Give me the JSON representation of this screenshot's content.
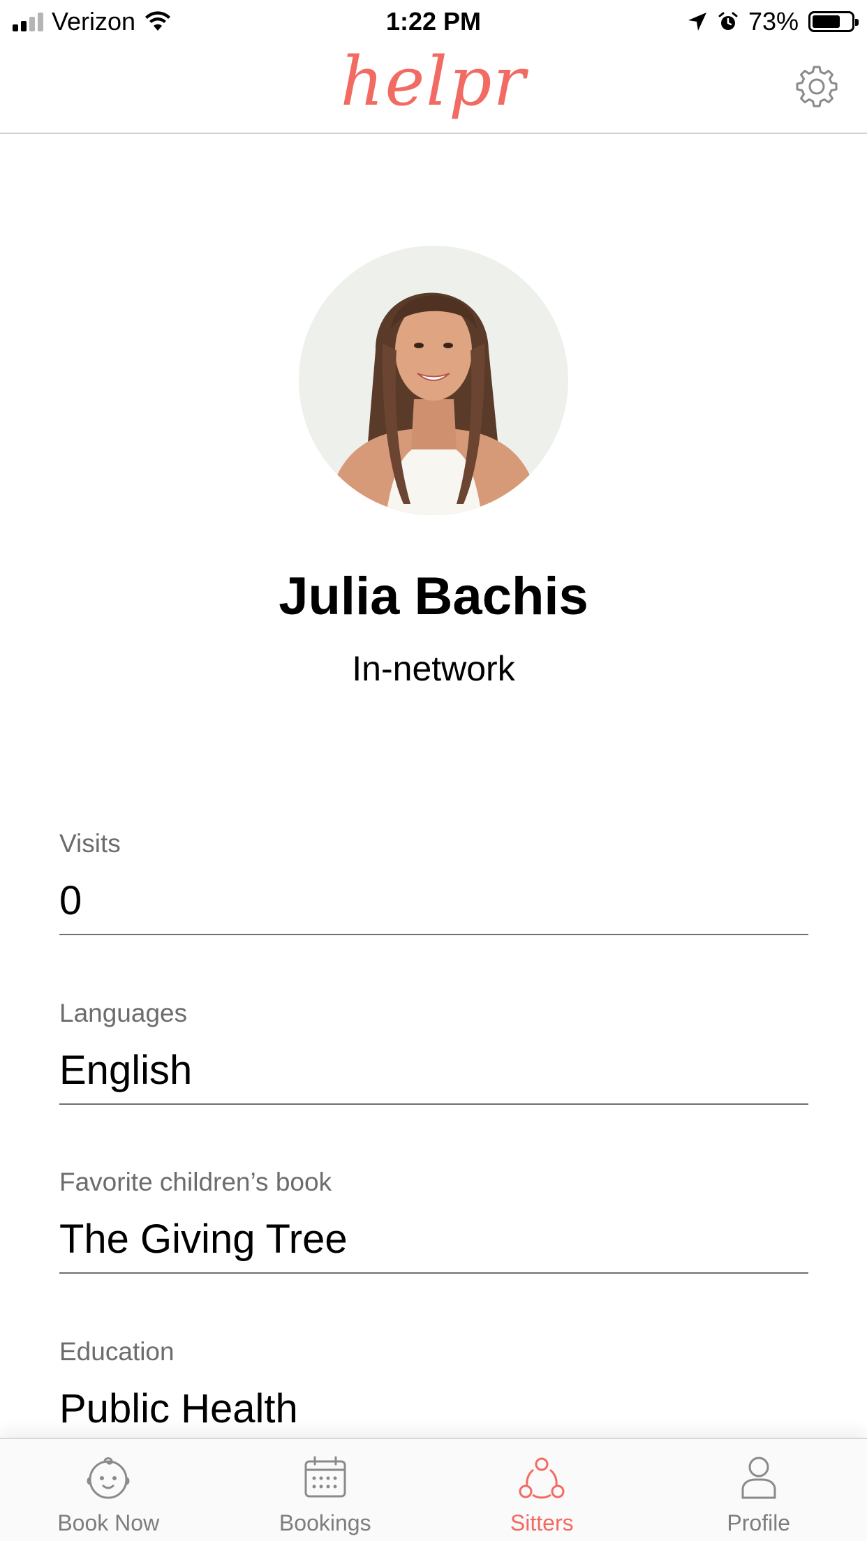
{
  "status_bar": {
    "carrier": "Verizon",
    "time": "1:22 PM",
    "battery_percent": "73%",
    "battery_level": 0.73,
    "icons": [
      "signal-icon",
      "wifi-icon",
      "location-arrow-icon",
      "alarm-icon",
      "battery-icon"
    ]
  },
  "header": {
    "logo": "helpr",
    "settings_icon": "gear-icon"
  },
  "profile": {
    "name": "Julia Bachis",
    "status": "In-network",
    "avatar": "avatar-photo"
  },
  "fields": [
    {
      "label": "Visits",
      "value": "0"
    },
    {
      "label": "Languages",
      "value": "English"
    },
    {
      "label": "Favorite children’s book",
      "value": "The Giving Tree"
    },
    {
      "label": "Education",
      "value": "Public Health"
    }
  ],
  "tabs": [
    {
      "label": "Book Now",
      "icon": "baby-face-icon",
      "active": false
    },
    {
      "label": "Bookings",
      "icon": "calendar-icon",
      "active": false
    },
    {
      "label": "Sitters",
      "icon": "sitters-network-icon",
      "active": true
    },
    {
      "label": "Profile",
      "icon": "person-icon",
      "active": false
    }
  ],
  "colors": {
    "accent": "#f26b63",
    "label_gray": "#6c6c6c",
    "tab_gray": "#7d7d7d"
  }
}
